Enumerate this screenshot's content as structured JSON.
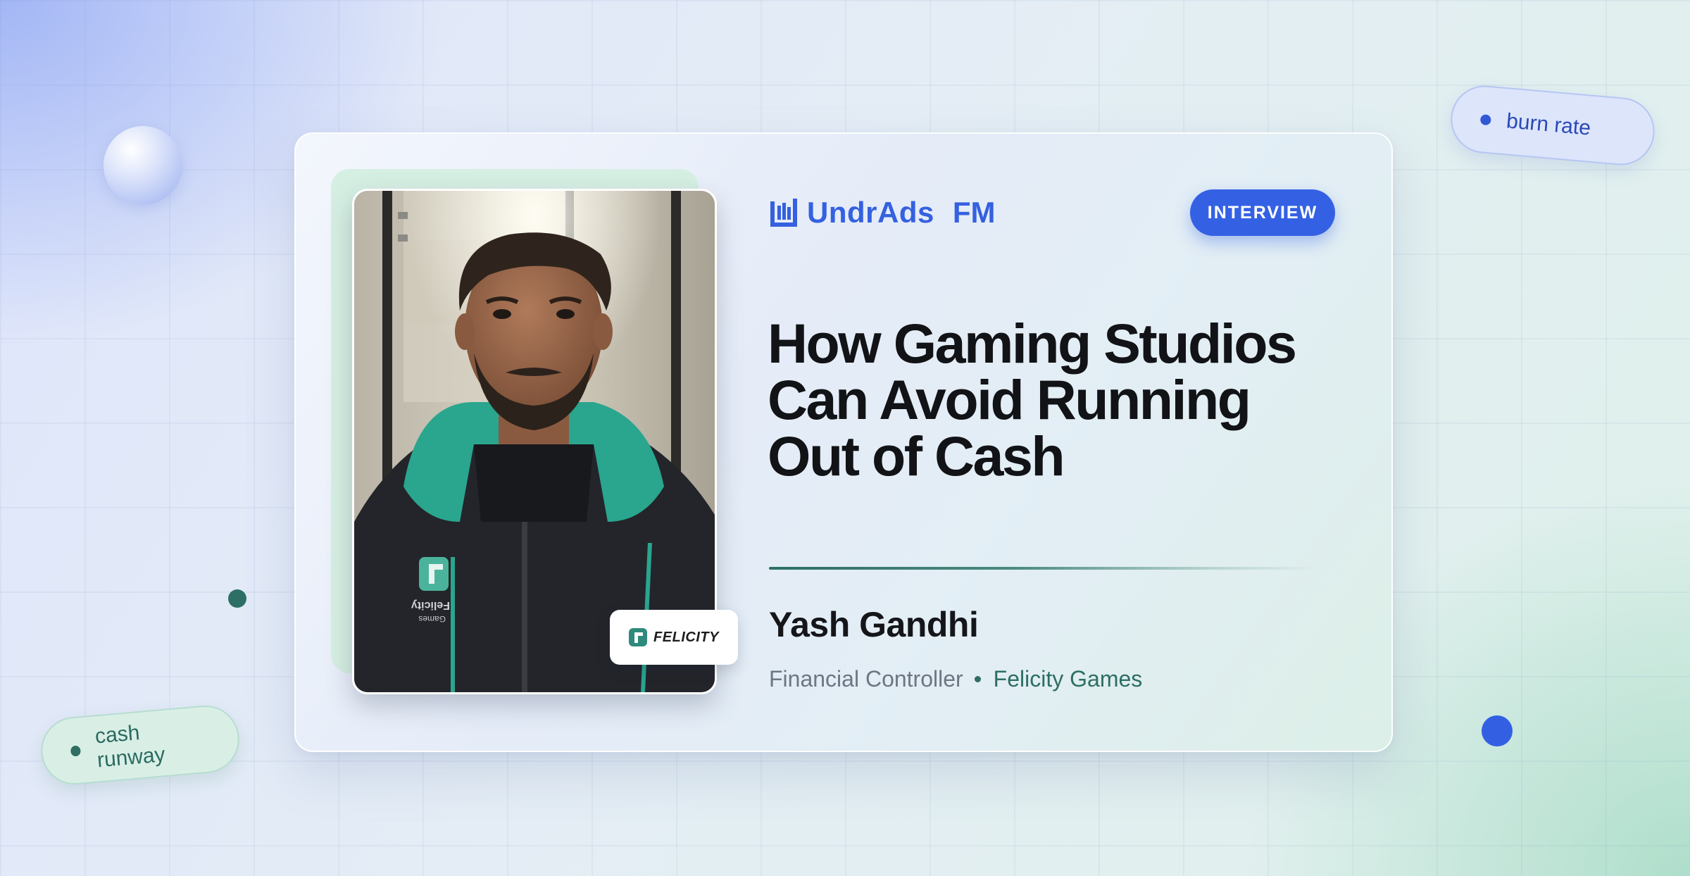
{
  "brand": {
    "name": "UndrAds",
    "suffix": "FM",
    "icon": "undrads-logo-icon",
    "color": "#3560e0"
  },
  "tag": {
    "label": "INTERVIEW",
    "color": "#3461e4"
  },
  "headline": {
    "line1": "How Gaming Studios",
    "line2": "Can Avoid Running",
    "line3": "Out of Cash"
  },
  "guest": {
    "name": "Yash Gandhi",
    "role": "Financial Controller",
    "company": "Felicity Games"
  },
  "photo_badge": {
    "label": "FELICITY",
    "icon": "felicity-logo-icon"
  },
  "hoodie_print": {
    "line1": "Felicity",
    "line2": "Games"
  },
  "floating_tags": {
    "burn_rate": "burn rate",
    "cash_runway": "cash runway"
  },
  "colors": {
    "accent_blue": "#3461e4",
    "accent_teal": "#2d6e63",
    "ink": "#121316"
  }
}
